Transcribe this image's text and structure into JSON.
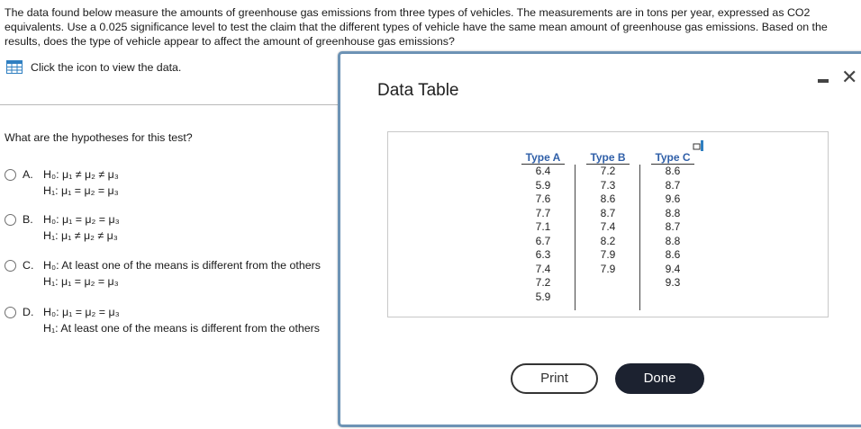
{
  "question": {
    "text": "The data found below measure the amounts of greenhouse gas emissions from three types of vehicles. The measurements are in tons per year, expressed as CO2 equivalents. Use a 0.025 significance level to test the claim that the different types of vehicle have the same mean amount of greenhouse gas emissions. Based on the results, does the type of vehicle appear to affect the amount of greenhouse gas emissions?"
  },
  "view_data_link": "Click the icon to view the data.",
  "hypotheses_question": "What are the hypotheses for this test?",
  "options": [
    {
      "letter": "A.",
      "h0": "H₀: μ₁ ≠ μ₂ ≠ μ₃",
      "h1": "H₁: μ₁ = μ₂ = μ₃"
    },
    {
      "letter": "B.",
      "h0": "H₀: μ₁ = μ₂ = μ₃",
      "h1": "H₁: μ₁ ≠ μ₂ ≠ μ₃"
    },
    {
      "letter": "C.",
      "h0": "H₀: At least one of the means is different from the others",
      "h1": "H₁: μ₁ = μ₂ = μ₃"
    },
    {
      "letter": "D.",
      "h0": "H₀: μ₁ = μ₂ = μ₃",
      "h1": "H₁: At least one of the means is different from the others"
    }
  ],
  "modal": {
    "title": "Data Table",
    "print_label": "Print",
    "done_label": "Done"
  },
  "table": {
    "columns": [
      {
        "header": "Type A",
        "values": [
          "6.4",
          "5.9",
          "7.6",
          "7.7",
          "7.1",
          "6.7",
          "6.3",
          "7.4",
          "7.2",
          "5.9"
        ]
      },
      {
        "header": "Type B",
        "values": [
          "7.2",
          "7.3",
          "8.6",
          "8.7",
          "7.4",
          "8.2",
          "7.9",
          "7.9"
        ]
      },
      {
        "header": "Type C",
        "values": [
          "8.6",
          "8.7",
          "9.6",
          "8.8",
          "8.7",
          "8.8",
          "8.6",
          "9.4",
          "9.3"
        ]
      }
    ]
  },
  "icons": {
    "table_icon": "table-icon",
    "copy_icon": "copy-icon",
    "minimize_icon": "minimize-icon",
    "close_icon": "close-icon"
  },
  "colors": {
    "modal_border": "#6d93b5",
    "header_text": "#2f5fa8",
    "done_button": "#1c2230"
  }
}
